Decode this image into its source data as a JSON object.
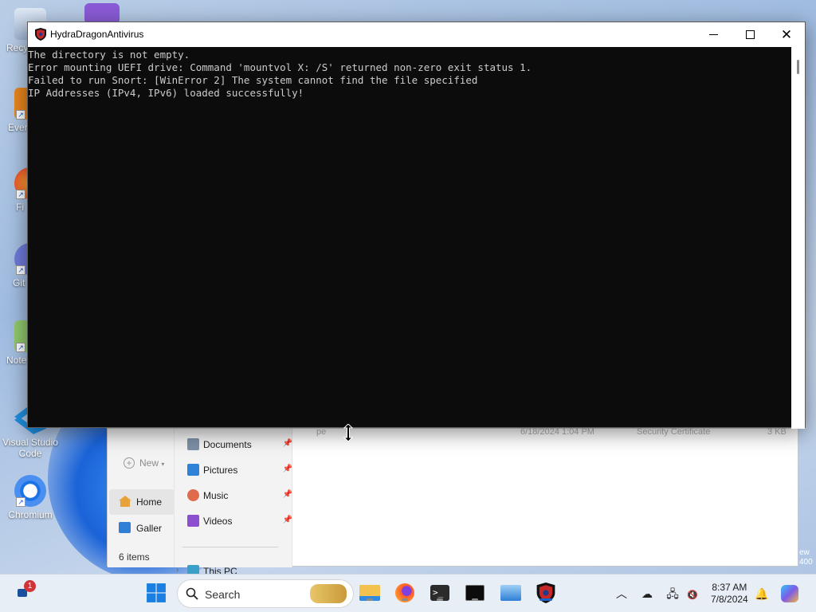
{
  "desktop": {
    "icons": [
      {
        "label": "Recy"
      },
      {
        "label": "Ever"
      },
      {
        "label": "Fi"
      },
      {
        "label": "Git"
      },
      {
        "label": "Note"
      },
      {
        "label": "Visual Studio Code"
      },
      {
        "label": "Chromium"
      }
    ],
    "edge_text": "ew\n400"
  },
  "console_window": {
    "title": "HydraDragonAntivirus",
    "lines": [
      "The directory is not empty.",
      "Error mounting UEFI drive: Command 'mountvol X: /S' returned non-zero exit status 1.",
      "Failed to run Snort: [WinError 2] The system cannot find the file specified",
      "IP Addresses (IPv4, IPv6) loaded successfully!"
    ],
    "background_color": "#0c0c0c",
    "text_color": "#cccccc"
  },
  "explorer": {
    "new_label": "New",
    "home_label": "Home",
    "gallery_label": "Galler",
    "item_count": "6 items",
    "nav": [
      {
        "label": "Documents",
        "icon": "documents-icon"
      },
      {
        "label": "Pictures",
        "icon": "pictures-icon"
      },
      {
        "label": "Music",
        "icon": "music-icon"
      },
      {
        "label": "Videos",
        "icon": "videos-icon"
      }
    ],
    "this_pc": "This PC",
    "faded_row": {
      "name": "pe",
      "date": "6/18/2024 1:04 PM",
      "type": "Security Certificate",
      "size": "3 KB"
    }
  },
  "taskbar": {
    "search_placeholder": "Search",
    "notification_count": "1",
    "time": "8:37 AM",
    "date": "7/8/2024",
    "accent": "#1a62c9"
  }
}
